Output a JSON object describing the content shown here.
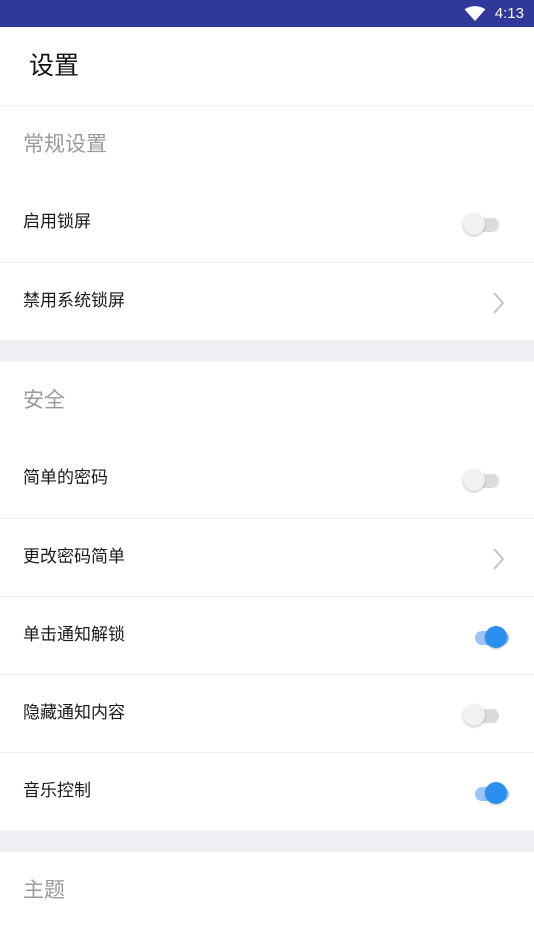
{
  "status_bar": {
    "time": "4:13",
    "background": "#30389c",
    "icons": [
      "wifi-icon"
    ]
  },
  "app_bar": {
    "title": "设置"
  },
  "sections": [
    {
      "header": "常规设置",
      "items": [
        {
          "label": "启用锁屏",
          "control": "switch",
          "checked": false
        },
        {
          "label": "禁用系统锁屏",
          "control": "chevron"
        }
      ]
    },
    {
      "header": "安全",
      "items": [
        {
          "label": "简单的密码",
          "control": "switch",
          "checked": false
        },
        {
          "label": "更改密码简单",
          "control": "chevron"
        },
        {
          "label": "单击通知解锁",
          "control": "switch",
          "checked": true
        },
        {
          "label": "隐藏通知内容",
          "control": "switch",
          "checked": false
        },
        {
          "label": "音乐控制",
          "control": "switch",
          "checked": true
        }
      ]
    },
    {
      "header": "主题",
      "items": []
    }
  ],
  "colors": {
    "accent": "#2a8fef",
    "section_header_text": "#9a9a9a",
    "divider_band": "#efeff4"
  }
}
